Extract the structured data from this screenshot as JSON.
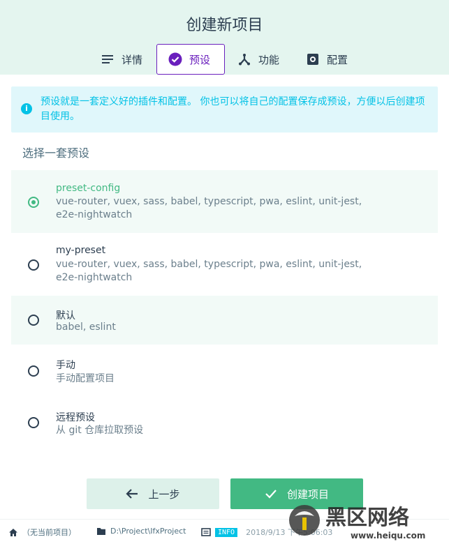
{
  "header": {
    "title": "创建新项目",
    "tabs": [
      {
        "label": "详情",
        "icon": "list-icon"
      },
      {
        "label": "预设",
        "icon": "check-circle-icon",
        "active": true
      },
      {
        "label": "功能",
        "icon": "fork-icon"
      },
      {
        "label": "配置",
        "icon": "gear-icon"
      }
    ]
  },
  "info": {
    "text": "预设就是一套定义好的插件和配置。 你也可以将自己的配置保存成预设，方便以后创建项目使用。"
  },
  "section_label": "选择一套预设",
  "presets": [
    {
      "name": "preset-config",
      "desc": "vue-router, vuex, sass, babel, typescript, pwa, eslint, unit-jest, e2e-nightwatch",
      "selected": true
    },
    {
      "name": "my-preset",
      "desc": "vue-router, vuex, sass, babel, typescript, pwa, eslint, unit-jest, e2e-nightwatch",
      "selected": false
    },
    {
      "name": "默认",
      "desc": "babel, eslint",
      "selected": false
    },
    {
      "name": "手动",
      "desc": "手动配置项目",
      "selected": false
    },
    {
      "name": "远程预设",
      "desc": "从 git 仓库拉取预设",
      "selected": false
    }
  ],
  "buttons": {
    "prev": "上一步",
    "create": "创建项目"
  },
  "statusbar": {
    "project": "（无当前项目）",
    "path": "D:\\Project\\IfxProject",
    "log_level": "INFO",
    "timestamp": "2018/9/13 下午5:06:03"
  },
  "watermark": {
    "text": "黑区网络",
    "url": "www.heiqu.com"
  },
  "colors": {
    "accent": "#42b983",
    "active_tab": "#6a1fbd",
    "info": "#03c2e6",
    "header_bg": "#e4f5ef"
  }
}
